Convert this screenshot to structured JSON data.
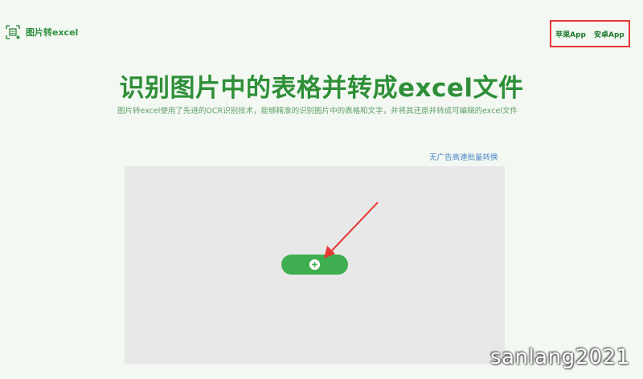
{
  "header": {
    "logo_text": "图片转excel",
    "logo_icon": "scan-document-icon",
    "app_links": [
      {
        "label": "苹果App"
      },
      {
        "label": "安卓App"
      }
    ],
    "highlight_color": "#e53935"
  },
  "hero": {
    "title": "识别图片中的表格并转成excel文件",
    "subtitle": "图片转excel使用了先进的OCR识别技术，能够精准的识别图片中的表格和文字，并将其还原并转成可编辑的excel文件"
  },
  "batch_link": "无广告高速批量转换",
  "upload": {
    "button_icon": "plus-circle-icon",
    "accent_color": "#3fae50"
  },
  "annotation": {
    "arrow_color": "#e53935"
  },
  "watermark": "sanlang2021"
}
